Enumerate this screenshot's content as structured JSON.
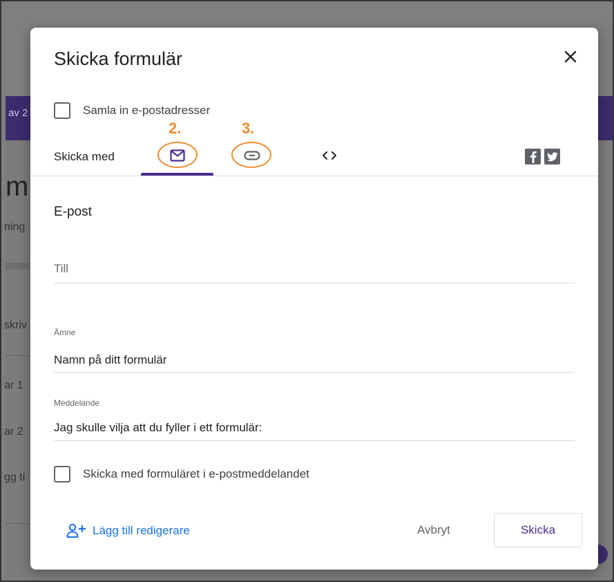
{
  "background": {
    "band_text": "av 2",
    "big_text": "m",
    "side_texts": [
      "ning",
      "skriv",
      "ar 1",
      "ar 2",
      "gg ti"
    ]
  },
  "dialog": {
    "title": "Skicka formulär",
    "collect_email_label": "Samla in e-postadresser",
    "send_with_label": "Skicka med",
    "annotations": [
      "2.",
      "3."
    ],
    "tabs": [
      {
        "icon": "mail-icon",
        "selected": true
      },
      {
        "icon": "link-icon",
        "selected": false
      },
      {
        "icon": "embed-code-icon",
        "selected": false
      }
    ],
    "social": [
      "facebook-icon",
      "twitter-icon"
    ],
    "email": {
      "section_title": "E-post",
      "to_placeholder": "Till",
      "subject_label": "Ämne",
      "subject_value": "Namn på ditt formulär",
      "message_label": "Meddelande",
      "message_value": "Jag skulle vilja att du fyller i ett formulär:",
      "include_form_label": "Skicka med formuläret i e-postmeddelandet"
    },
    "footer": {
      "add_editor_label": "Lägg till redigerare",
      "cancel_label": "Avbryt",
      "send_label": "Skicka"
    }
  },
  "colors": {
    "accent": "#4b2c8f",
    "link": "#1a73e8",
    "annotation": "#f08a2c"
  }
}
